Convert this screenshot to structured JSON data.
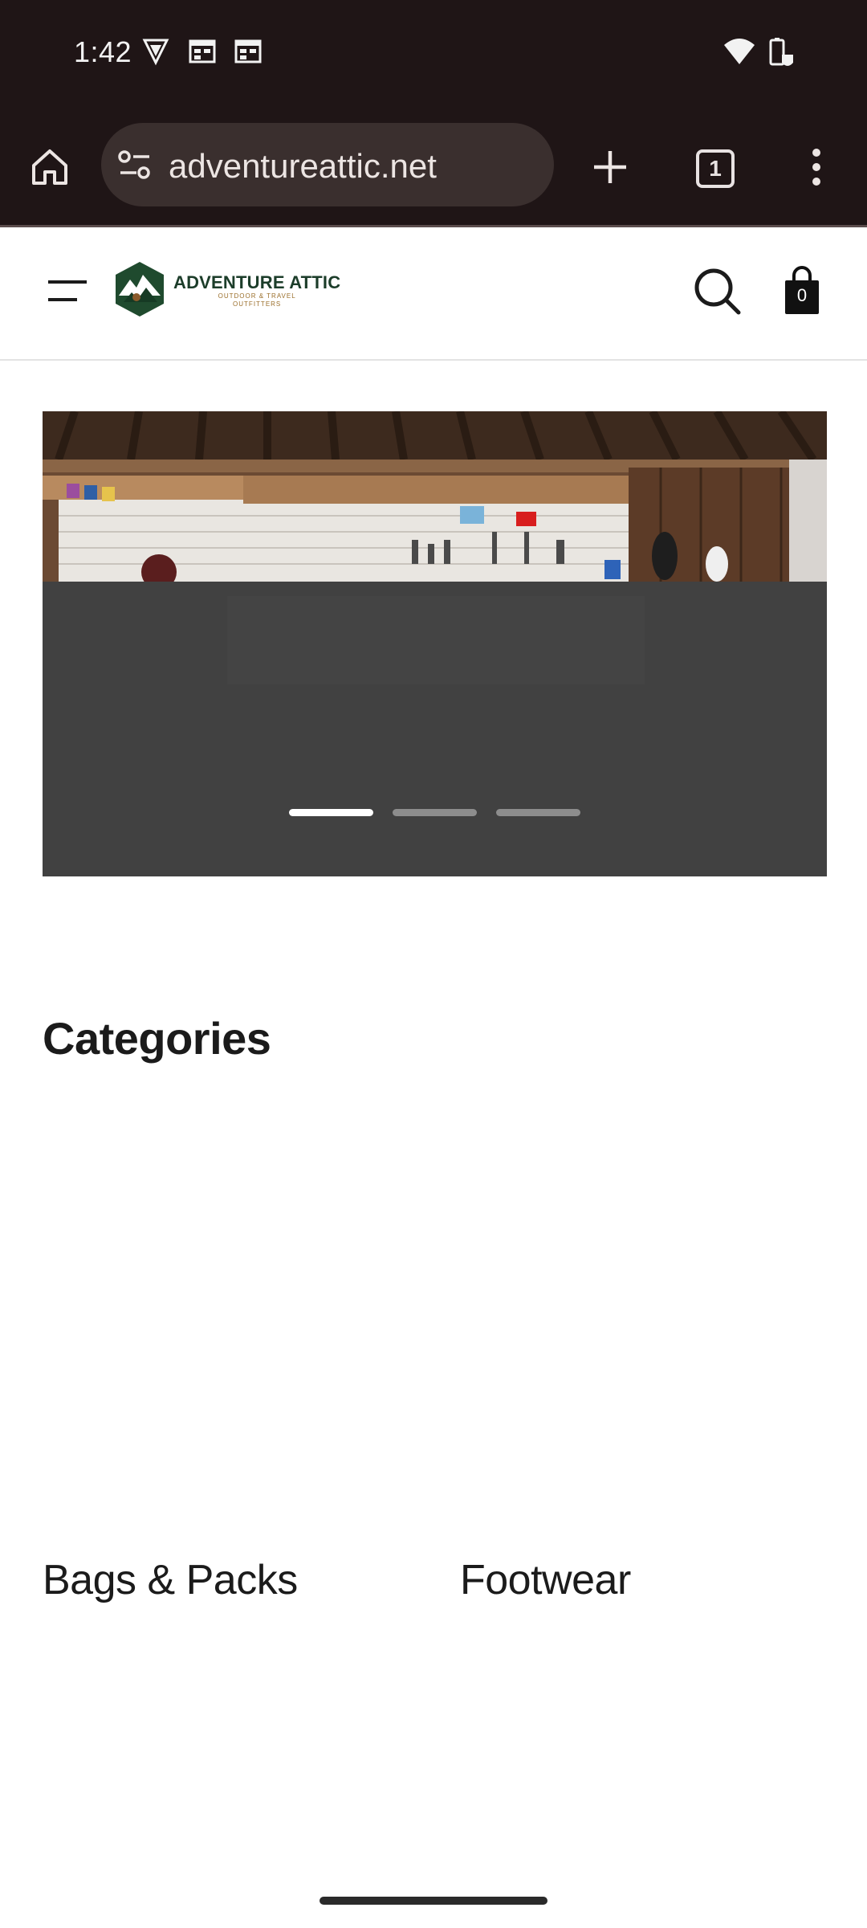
{
  "status_bar": {
    "time": "1:42",
    "left_icons": [
      "vpn-shield-icon",
      "calendar-icon",
      "calendar-icon"
    ],
    "right_icons": [
      "wifi-icon",
      "battery-saver-icon"
    ]
  },
  "browser": {
    "url": "adventureattic.net",
    "tab_count": "1",
    "buttons": [
      "home-icon",
      "site-settings-icon",
      "new-tab-icon",
      "tab-switcher",
      "overflow-menu-icon"
    ]
  },
  "site": {
    "logo_title": "ADVENTURE ATTIC",
    "logo_subtitle_1": "OUTDOOR & TRAVEL",
    "logo_subtitle_2": "OUTFITTERS",
    "cart_count": "0"
  },
  "hero": {
    "slide_count": 3,
    "active_slide": 1
  },
  "sections": {
    "categories_title": "Categories",
    "categories": [
      {
        "label": "Bags & Packs"
      },
      {
        "label": "Footwear"
      }
    ]
  },
  "colors": {
    "chrome_bg": "#1f1516",
    "url_bar_bg": "#3a2f2e",
    "hero_overlay": "#414141",
    "brand_green": "#1c3d2a",
    "brand_gold": "#9b6f2b"
  }
}
